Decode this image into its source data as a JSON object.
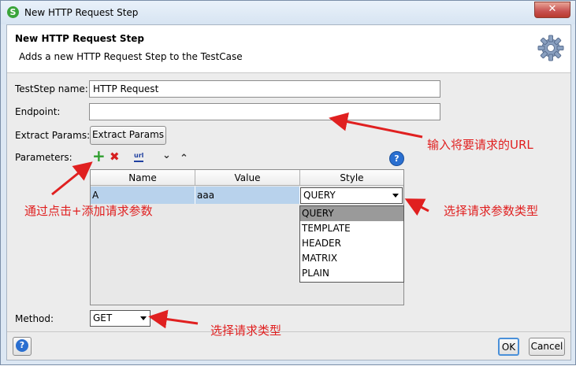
{
  "window": {
    "title": "New HTTP Request Step",
    "close_label": "✕"
  },
  "header": {
    "title": "New HTTP Request Step",
    "subtitle": "Adds a new HTTP Request Step to the TestCase"
  },
  "form": {
    "teststep_label": "TestStep name:",
    "teststep_value": "HTTP Request",
    "endpoint_label": "Endpoint:",
    "endpoint_value": "",
    "extract_label": "Extract Params:",
    "extract_button": "Extract Params",
    "parameters_label": "Parameters:",
    "method_label": "Method:",
    "method_value": "GET"
  },
  "toolbar": {
    "add_icon": "+",
    "remove_icon": "✖",
    "url_icon": "url",
    "down_icon": "⌄",
    "up_icon": "⌃",
    "help_icon": "?"
  },
  "table": {
    "columns": [
      "Name",
      "Value",
      "Style"
    ],
    "rows": [
      {
        "name": "A",
        "value": "aaa",
        "style": "QUERY"
      }
    ]
  },
  "style_options": [
    "QUERY",
    "TEMPLATE",
    "HEADER",
    "MATRIX",
    "PLAIN"
  ],
  "annotations": {
    "url": "输入将要请求的URL",
    "add": "通过点击+添加请求参数",
    "style": "选择请求参数类型",
    "method": "选择请求类型"
  },
  "footer": {
    "help_icon": "?",
    "ok": "OK",
    "cancel": "Cancel"
  },
  "colors": {
    "accent": "#3aa43a",
    "annotation": "#e02020",
    "selected_row": "#b8d2ec"
  }
}
